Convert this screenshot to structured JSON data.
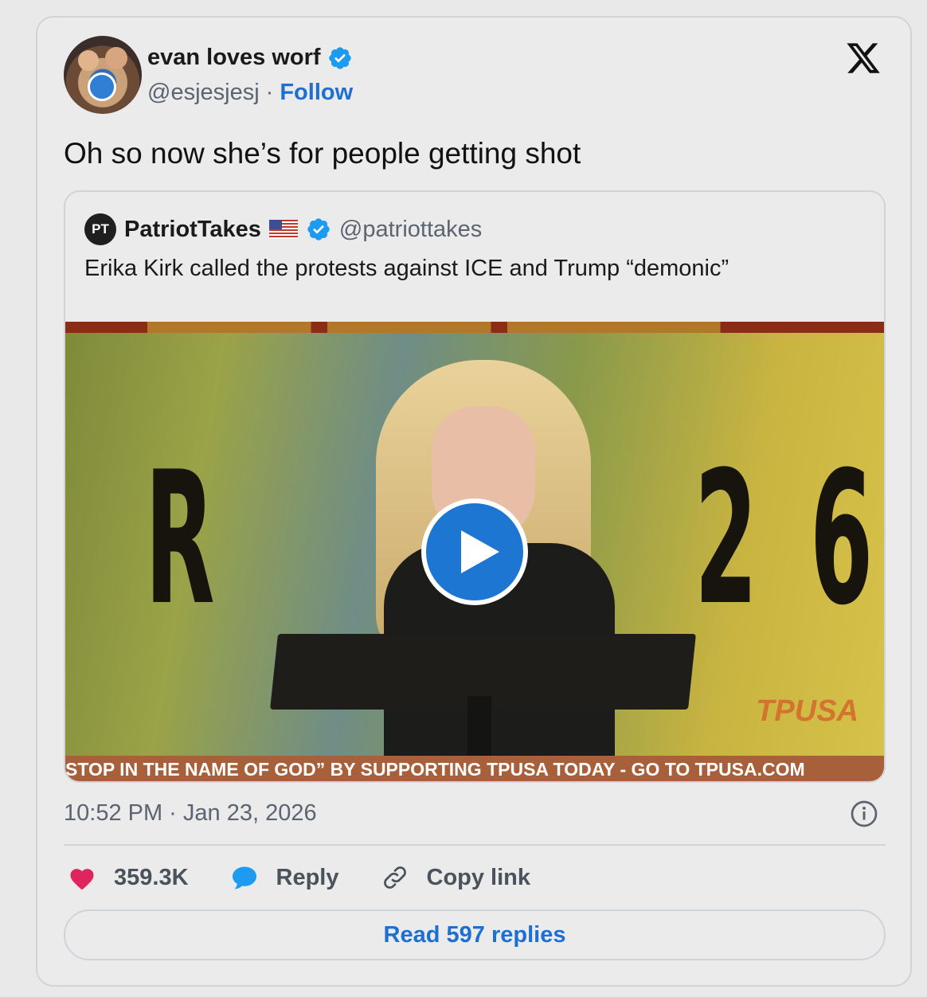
{
  "author": {
    "display_name": "evan loves worf",
    "handle": "@esjesjesj",
    "separator": "·",
    "follow_label": "Follow",
    "verified": true
  },
  "tweet": {
    "text": "Oh so now she’s for people getting shot",
    "timestamp": "10:52 PM · Jan 23, 2026"
  },
  "quoted": {
    "avatar_initials": "PT",
    "display_name": "PatriotTakes",
    "handle": "@patriottakes",
    "text": "Erika Kirk called  the protests against ICE and Trump “demonic”",
    "video": {
      "ticker_text": "STOP IN THE NAME OF GOD” BY SUPPORTING TPUSA TODAY - GO TO TPUSA.COM",
      "watermark": "TPUSA",
      "bg_letters": [
        "R",
        "2",
        "6"
      ]
    }
  },
  "actions": {
    "likes_count": "359.3K",
    "reply_label": "Reply",
    "copy_link_label": "Copy link"
  },
  "read_replies_label": "Read 597 replies",
  "colors": {
    "accent": "#1d6fd1",
    "like": "#e0245e",
    "verified": "#1d9bf0"
  }
}
